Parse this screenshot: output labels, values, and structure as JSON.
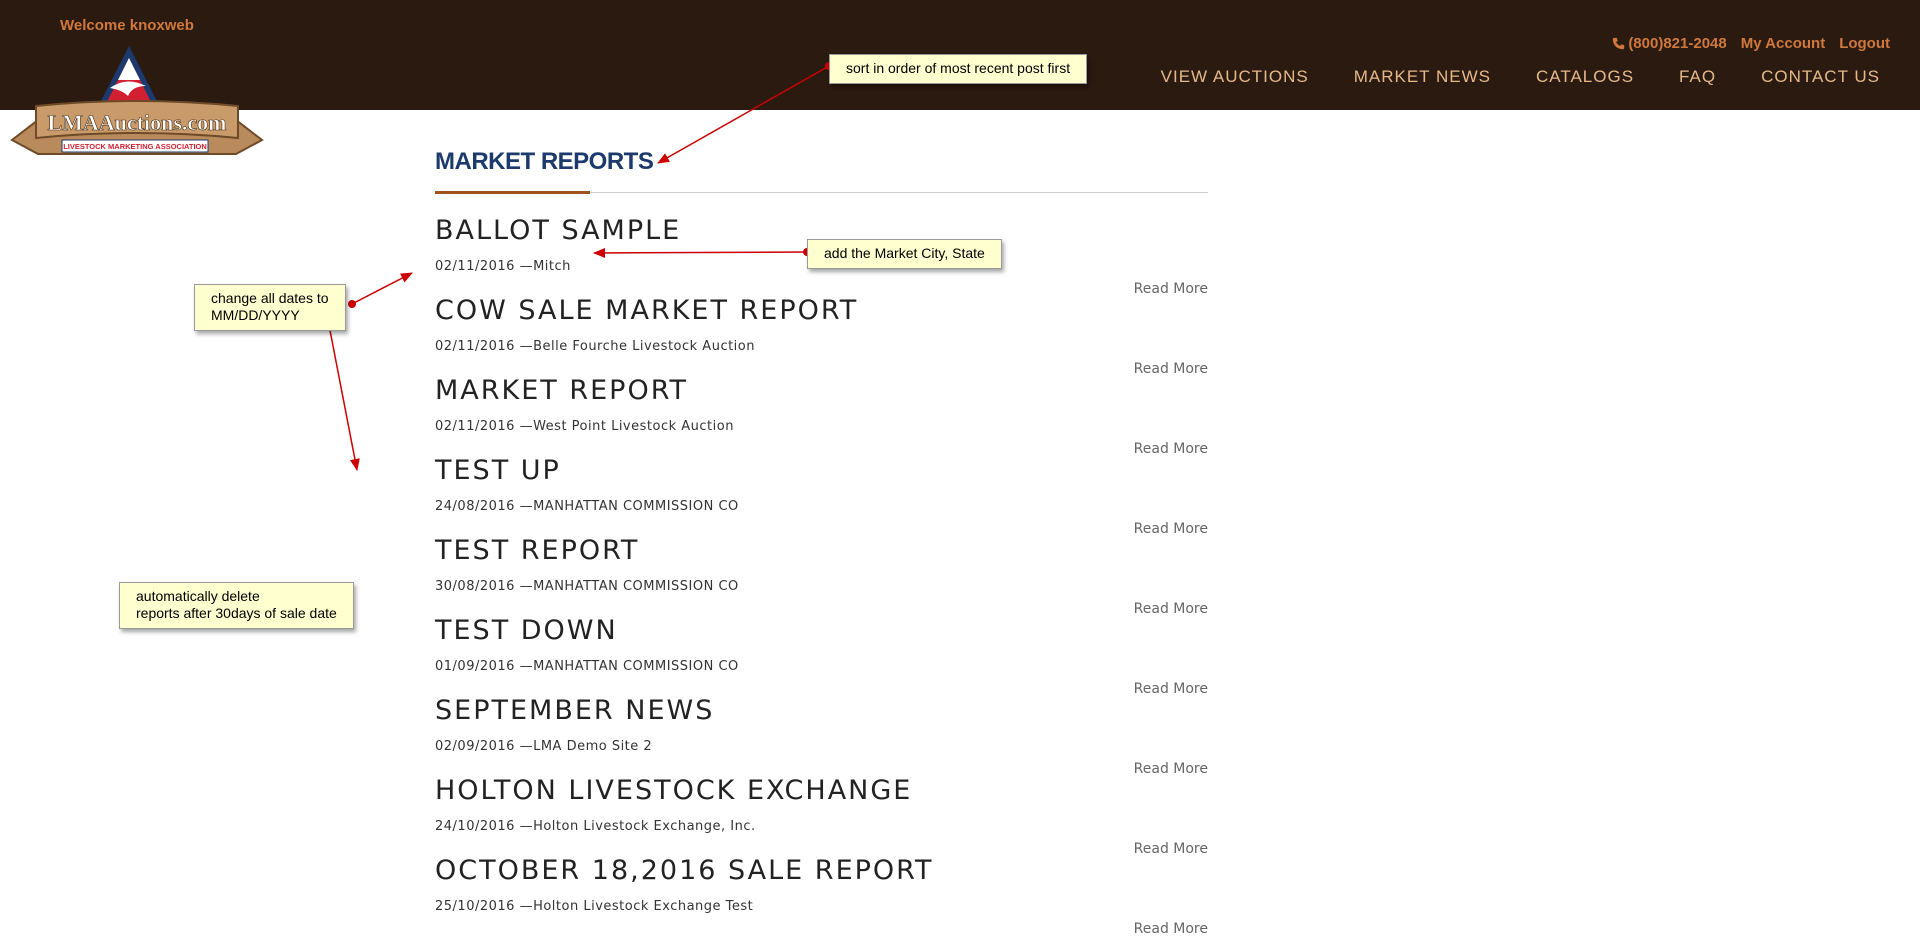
{
  "header": {
    "welcome": "Welcome knoxweb",
    "logo_text": "LMAAuctions.com",
    "logo_subtext": "LIVESTOCK MARKETING ASSOCIATION",
    "phone": "(800)821-2048",
    "my_account": "My Account",
    "logout": "Logout",
    "nav": [
      "VIEW AUCTIONS",
      "MARKET NEWS",
      "CATALOGS",
      "FAQ",
      "CONTACT US"
    ]
  },
  "main": {
    "title": "MARKET REPORTS",
    "read_more_label": "Read More",
    "reports": [
      {
        "title": "BALLOT SAMPLE",
        "date": "02/11/2016",
        "source": "Mitch"
      },
      {
        "title": "COW SALE MARKET REPORT",
        "date": "02/11/2016",
        "source": "Belle Fourche Livestock Auction"
      },
      {
        "title": "MARKET REPORT",
        "date": "02/11/2016",
        "source": "West Point Livestock Auction"
      },
      {
        "title": "TEST UP",
        "date": "24/08/2016",
        "source": "MANHATTAN COMMISSION CO"
      },
      {
        "title": "TEST REPORT",
        "date": "30/08/2016",
        "source": "MANHATTAN COMMISSION CO"
      },
      {
        "title": "TEST DOWN",
        "date": "01/09/2016",
        "source": "MANHATTAN COMMISSION CO"
      },
      {
        "title": "SEPTEMBER NEWS",
        "date": "02/09/2016",
        "source": "LMA Demo Site 2"
      },
      {
        "title": "HOLTON LIVESTOCK EXCHANGE",
        "date": "24/10/2016",
        "source": "Holton Livestock Exchange, Inc."
      },
      {
        "title": "OCTOBER 18,2016 SALE REPORT",
        "date": "25/10/2016",
        "source": "Holton Livestock Exchange Test"
      }
    ]
  },
  "annotations": {
    "sort_note": "sort in order of most recent post first",
    "city_note": "add the Market City, State",
    "date_note": "change all dates to\nMM/DD/YYYY",
    "delete_note": "automatically delete\nreports after 30days of sale date"
  },
  "colors": {
    "header_bg": "#2a1a10",
    "accent_orange": "#d1793d",
    "nav_text": "#e6b98a",
    "title_blue": "#1c3a6b",
    "note_bg": "#ffffd0",
    "arrow_red": "#cc0000"
  }
}
